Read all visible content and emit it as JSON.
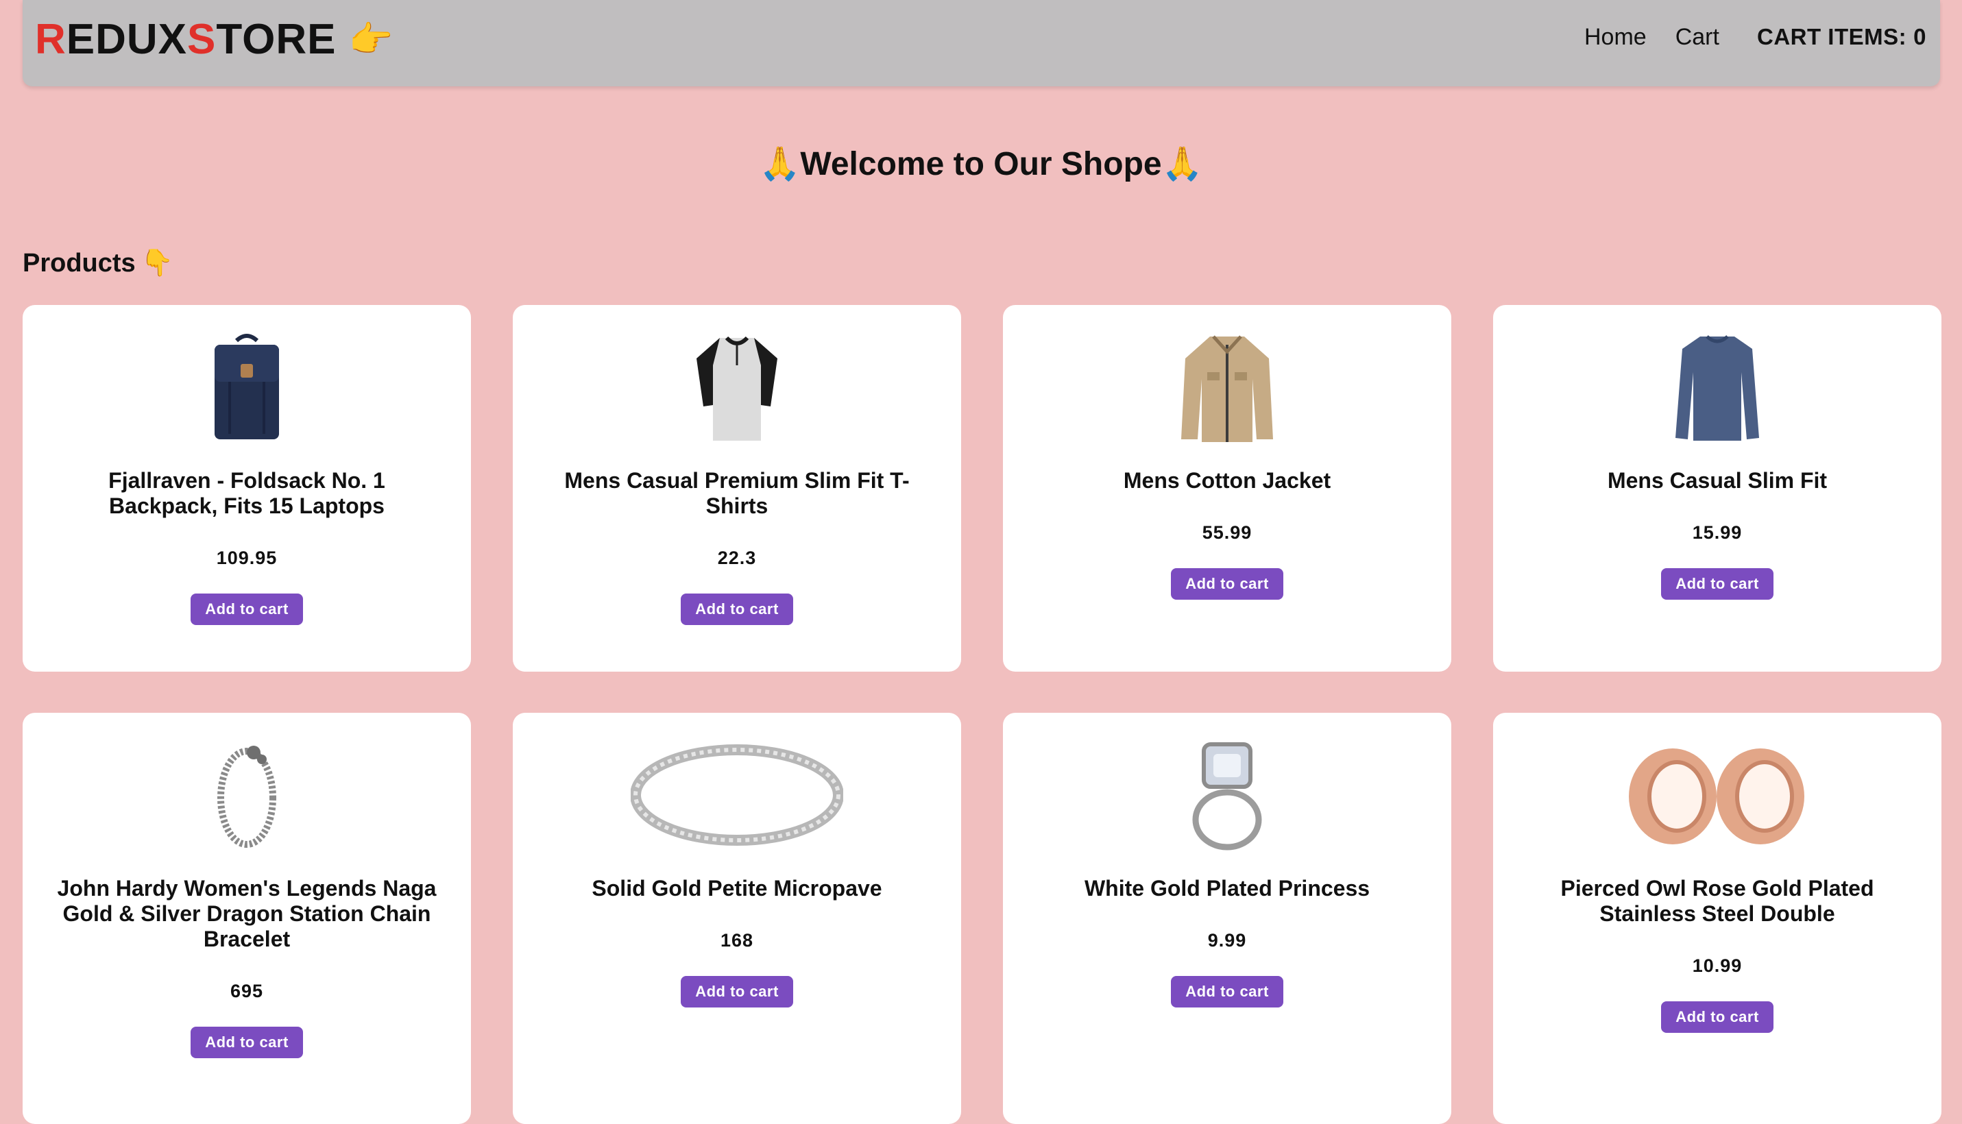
{
  "header": {
    "brand": {
      "r": "R",
      "edux": "EDUX ",
      "s": "S",
      "tore": "TORE",
      "emoji": "👉"
    },
    "nav": {
      "home": "Home",
      "cart": "Cart"
    },
    "cart_label": "CART ITEMS:",
    "cart_count": "0"
  },
  "welcome": "🙏Welcome to Our Shope🙏",
  "section": {
    "title": "Products",
    "emoji": "👇"
  },
  "add_label": "Add to cart",
  "products": [
    {
      "name": "Fjallraven - Foldsack No. 1 Backpack, Fits 15 Laptops",
      "price": "109.95",
      "icon": "backpack-icon"
    },
    {
      "name": "Mens Casual Premium Slim Fit T-Shirts",
      "price": "22.3",
      "icon": "tshirt-icon"
    },
    {
      "name": "Mens Cotton Jacket",
      "price": "55.99",
      "icon": "jacket-icon"
    },
    {
      "name": "Mens Casual Slim Fit",
      "price": "15.99",
      "icon": "longsleeve-icon"
    },
    {
      "name": "John Hardy Women's Legends Naga Gold & Silver Dragon Station Chain Bracelet",
      "price": "695",
      "icon": "bracelet-icon"
    },
    {
      "name": "Solid Gold Petite Micropave",
      "price": "168",
      "icon": "ring-band-icon"
    },
    {
      "name": "White Gold Plated Princess",
      "price": "9.99",
      "icon": "diamond-ring-icon"
    },
    {
      "name": "Pierced Owl Rose Gold Plated Stainless Steel Double",
      "price": "10.99",
      "icon": "tunnel-plugs-icon"
    }
  ],
  "colors": {
    "background": "#f1bfbf",
    "navbar": "#c0bebf",
    "accent_red": "#e0302a",
    "button": "#7b4cc0"
  }
}
